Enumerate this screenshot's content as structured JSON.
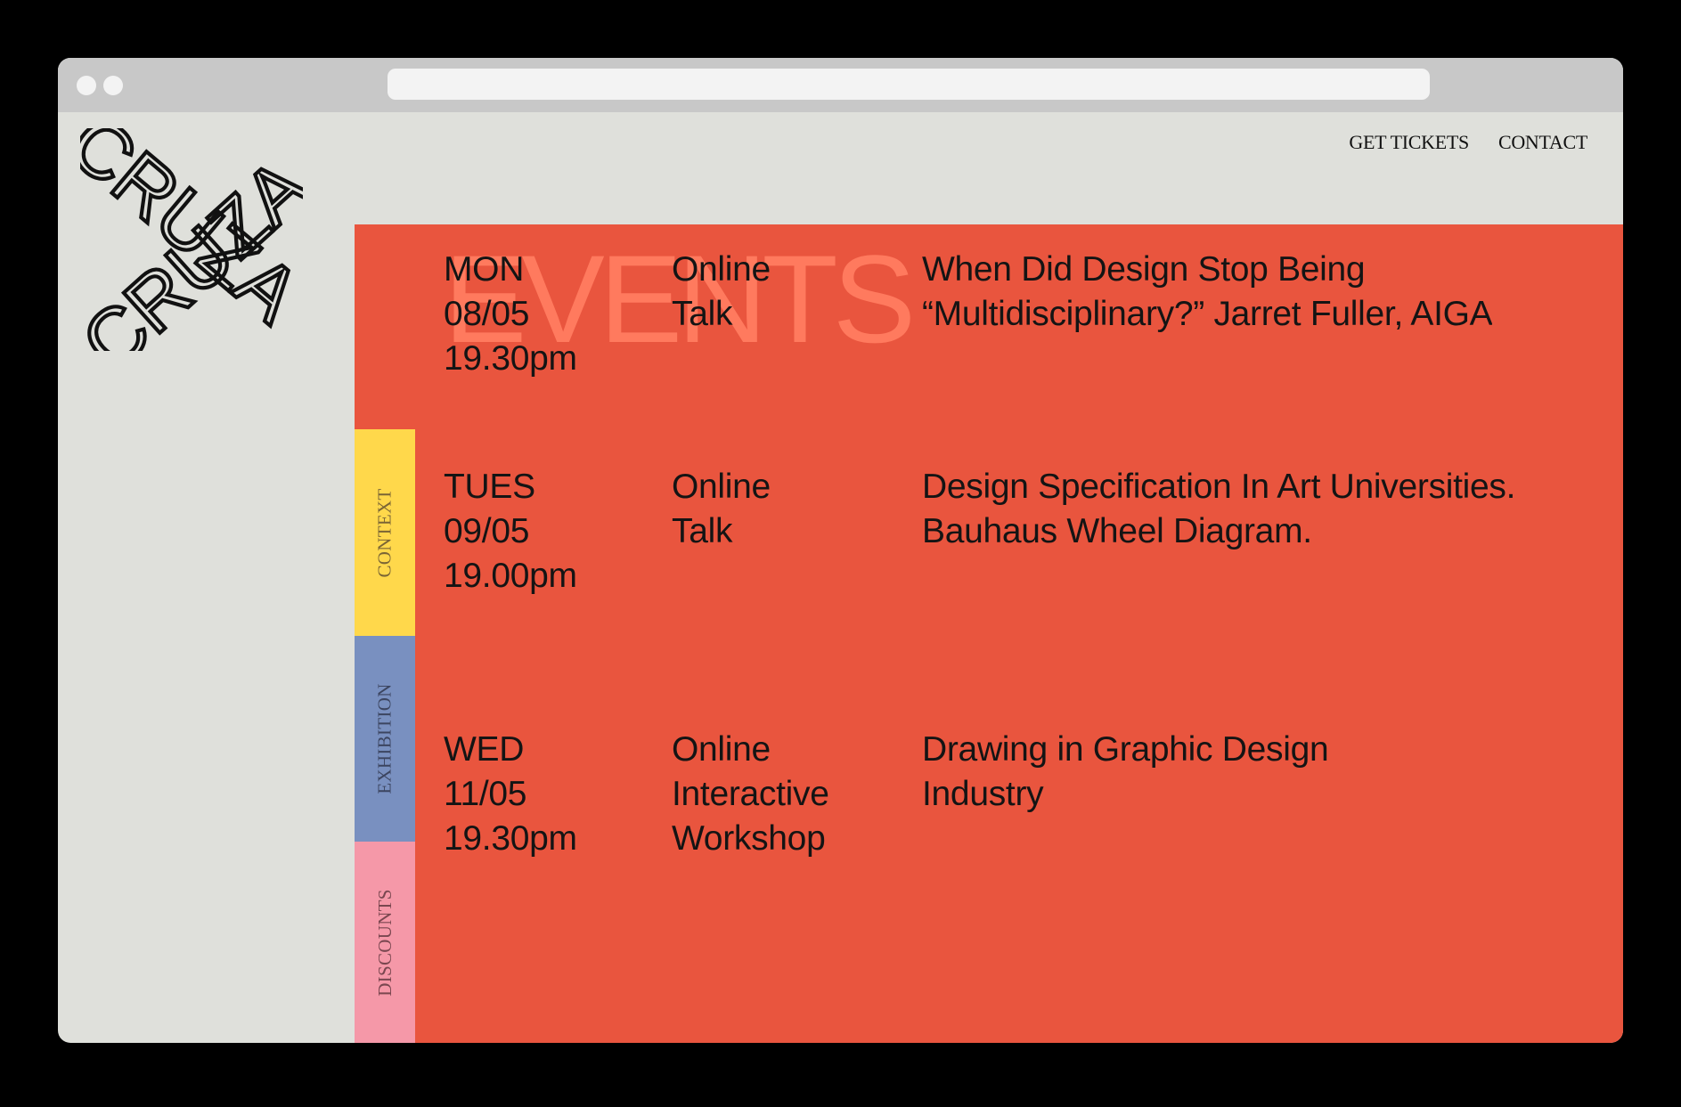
{
  "brand": {
    "logo_text": "CRUZA"
  },
  "nav": {
    "get_tickets": "GET TICKETS",
    "contact": "CONTACT"
  },
  "section": {
    "title": "EVENTS"
  },
  "side_tabs": [
    {
      "label": "CONTEXT",
      "color": "#ffd84b"
    },
    {
      "label": "EXHIBITION",
      "color": "#7990c0"
    },
    {
      "label": "DISCOUNTS",
      "color": "#f598a8"
    }
  ],
  "events": [
    {
      "day": "MON",
      "date": "08/05",
      "time": "19.30pm",
      "type_lines": [
        "Online",
        "Talk"
      ],
      "title_lines": [
        "When Did Design Stop Being",
        "“Multidisciplinary?” Jarret Fuller, AIGA"
      ]
    },
    {
      "day": "TUES",
      "date": "09/05",
      "time": "19.00pm",
      "type_lines": [
        "Online",
        "Talk"
      ],
      "title_lines": [
        "Design Specification In Art Universities.",
        "Bauhaus Wheel Diagram."
      ]
    },
    {
      "day": "WED",
      "date": "11/05",
      "time": "19.30pm",
      "type_lines": [
        "Online",
        "Interactive",
        "Workshop"
      ],
      "title_lines": [
        "Drawing in Graphic Design",
        "Industry"
      ]
    }
  ],
  "colors": {
    "panel": "#e9553e",
    "events_title": "#ff7a5e",
    "background": "#dfe0db"
  }
}
